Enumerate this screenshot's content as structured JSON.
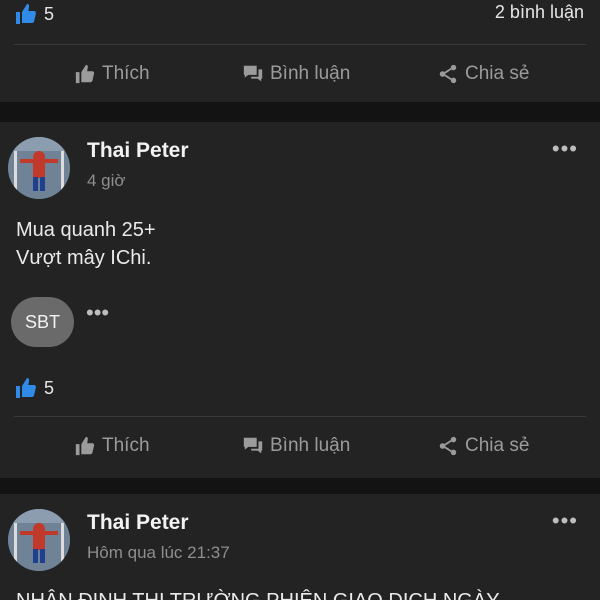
{
  "post_prev": {
    "like_count": "5",
    "comment_count": "2 bình luận"
  },
  "actions": {
    "like_label": "Thích",
    "comment_label": "Bình luận",
    "share_label": "Chia sẻ"
  },
  "post_1": {
    "author": "Thai Peter",
    "time": "4 giờ",
    "body": "Mua quanh 25+\nVượt mây IChi.",
    "reaction_chip": "SBT",
    "like_count": "5"
  },
  "post_2": {
    "author": "Thai Peter",
    "time": "Hôm qua lúc 21:37",
    "body_preview": "NHẬN ĐỊNH THỊ TRƯỜNG PHIÊN GIAO DỊCH NGÀY"
  },
  "colors": {
    "background": "#131313",
    "card": "#232323",
    "like_blue": "#2f8ae8",
    "muted_text": "#9b9b9b"
  },
  "icons": {
    "like_reaction": "thumbs-up-icon",
    "like_action": "thumbs-up-icon",
    "comment_action": "comment-bubbles-icon",
    "share_action": "share-icon",
    "more": "more-horizontal-icon"
  }
}
